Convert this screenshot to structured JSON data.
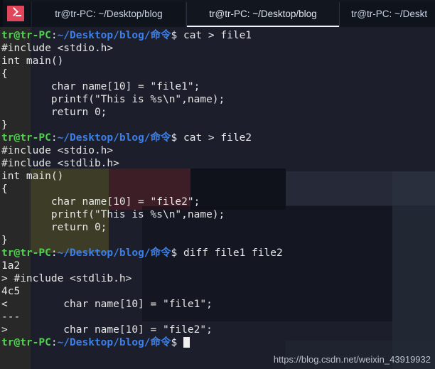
{
  "window": {
    "app_icon": "terminal-icon"
  },
  "tabs": [
    {
      "label": "tr@tr-PC: ~/Desktop/blog",
      "active": false
    },
    {
      "label": "tr@tr-PC: ~/Desktop/blog",
      "active": true
    },
    {
      "label": "tr@tr-PC: ~/Deskt",
      "active": false
    }
  ],
  "prompt": {
    "user": "tr@tr-PC",
    "colon": ":",
    "path": "~/Desktop/blog/命令",
    "sigil": "$ "
  },
  "lines": [
    {
      "type": "prompt",
      "command": "cat > file1"
    },
    {
      "type": "out",
      "text": "#include <stdio.h>"
    },
    {
      "type": "out",
      "text": "int main()"
    },
    {
      "type": "out",
      "text": "{"
    },
    {
      "type": "out",
      "text": "        char name[10] = \"file1\";"
    },
    {
      "type": "out",
      "text": "        printf(\"This is %s\\n\",name);"
    },
    {
      "type": "out",
      "text": "        return 0;"
    },
    {
      "type": "out",
      "text": "}"
    },
    {
      "type": "prompt",
      "command": "cat > file2"
    },
    {
      "type": "out",
      "text": "#include <stdio.h>"
    },
    {
      "type": "out",
      "text": "#include <stdlib.h>"
    },
    {
      "type": "out",
      "text": "int main()"
    },
    {
      "type": "out",
      "text": "{"
    },
    {
      "type": "out",
      "text": "        char name[10] = \"file2\";"
    },
    {
      "type": "out",
      "text": "        printf(\"This is %s\\n\",name);"
    },
    {
      "type": "out",
      "text": "        return 0;"
    },
    {
      "type": "out",
      "text": "}"
    },
    {
      "type": "prompt",
      "command": "diff file1 file2"
    },
    {
      "type": "out",
      "text": "1a2"
    },
    {
      "type": "out",
      "text": "> #include <stdlib.h>"
    },
    {
      "type": "out",
      "text": "4c5"
    },
    {
      "type": "out",
      "text": "<         char name[10] = \"file1\";"
    },
    {
      "type": "out",
      "text": "---"
    },
    {
      "type": "out",
      "text": ">         char name[10] = \"file2\";"
    },
    {
      "type": "prompt",
      "command": "",
      "cursor": true
    }
  ],
  "watermark": "https://blog.csdn.net/weixin_43919932",
  "colors": {
    "terminal_bg": "#1c1f2b",
    "tabbar_bg": "#0f131c",
    "prompt_user": "#4fd14f",
    "prompt_path": "#3b7fe8",
    "text": "#e6e6e6",
    "icon_red": "#e0475b",
    "active_tab_underline": "#f2f5fa"
  }
}
